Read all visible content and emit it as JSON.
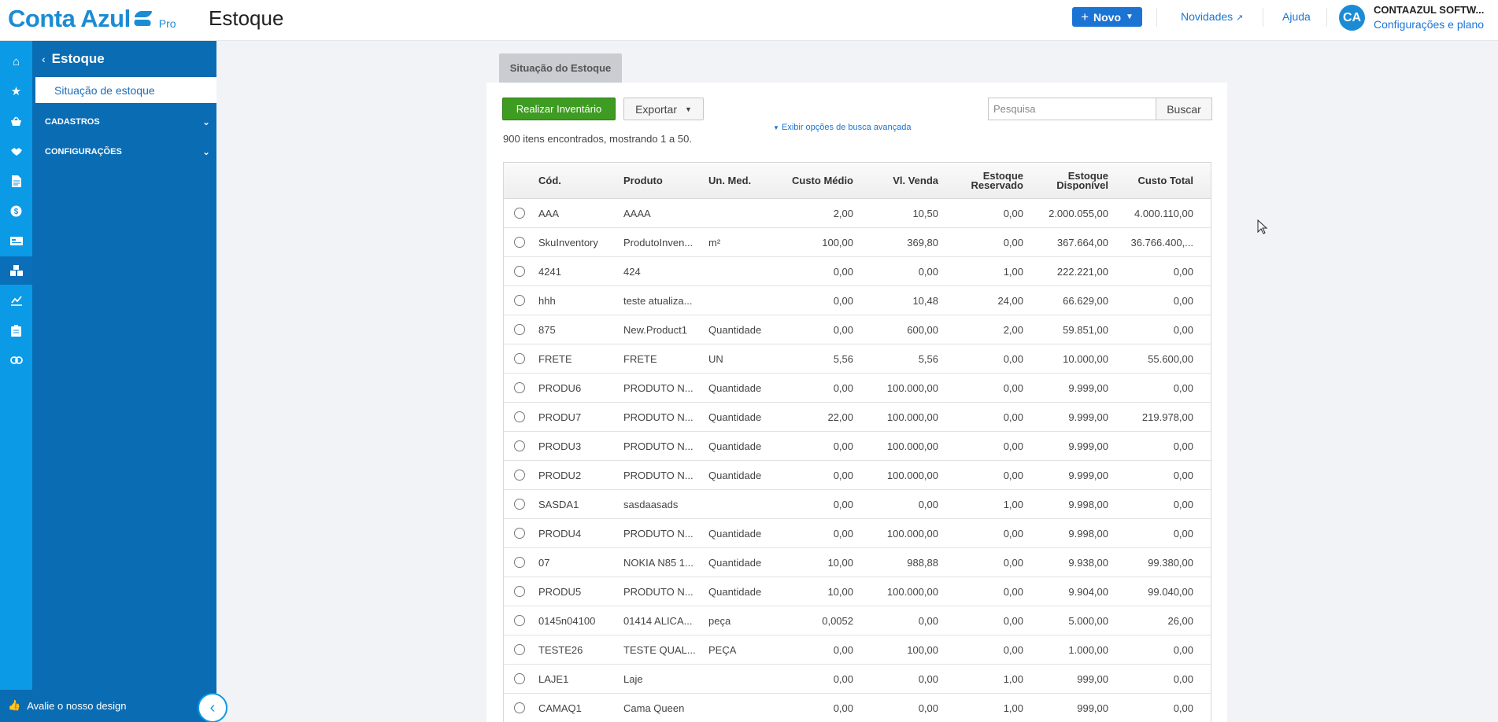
{
  "header": {
    "logo_text": "Conta Azul",
    "logo_pro": "Pro",
    "page_title": "Estoque",
    "novo_label": "Novo",
    "novidades_label": "Novidades",
    "ajuda_label": "Ajuda",
    "avatar_initials": "CA",
    "company_name": "CONTAAZUL SOFTW...",
    "config_link": "Configurações e plano"
  },
  "rail": {
    "icons": [
      "home-icon",
      "star-icon",
      "basket-icon",
      "handshake-icon",
      "document-icon",
      "money-icon",
      "card-icon",
      "inventory-icon",
      "chart-icon",
      "clipboard-icon",
      "link-icon"
    ],
    "active_icon": "inventory-icon"
  },
  "sidebar": {
    "title": "Estoque",
    "active_item": "Situação de estoque",
    "sections": [
      "CADASTROS",
      "CONFIGURAÇÕES"
    ],
    "rate_label": "Avalie o nosso design"
  },
  "main": {
    "tab_label": "Situação do Estoque",
    "inventory_button": "Realizar Inventário",
    "export_button": "Exportar",
    "search_placeholder": "Pesquisa",
    "search_button": "Buscar",
    "advanced_link": "Exibir opções de busca avançada",
    "results_text": "900 itens encontrados, mostrando 1 a 50."
  },
  "table": {
    "headers": {
      "cod": "Cód.",
      "produto": "Produto",
      "un": "Un. Med.",
      "custo": "Custo Médio",
      "venda": "Vl. Venda",
      "reservado": "Estoque Reservado",
      "disponivel": "Estoque Disponível",
      "total": "Custo Total"
    },
    "rows": [
      {
        "cod": "AAA",
        "produto": "AAAA",
        "un": "",
        "custo": "2,00",
        "venda": "10,50",
        "reservado": "0,00",
        "disponivel": "2.000.055,00",
        "total": "4.000.110,00"
      },
      {
        "cod": "SkuInventory",
        "produto": "ProdutoInven...",
        "un": "m²",
        "custo": "100,00",
        "venda": "369,80",
        "reservado": "0,00",
        "disponivel": "367.664,00",
        "total": "36.766.400,..."
      },
      {
        "cod": "4241",
        "produto": "424",
        "un": "",
        "custo": "0,00",
        "venda": "0,00",
        "reservado": "1,00",
        "disponivel": "222.221,00",
        "total": "0,00"
      },
      {
        "cod": "hhh",
        "produto": "teste atualiza...",
        "un": "",
        "custo": "0,00",
        "venda": "10,48",
        "reservado": "24,00",
        "disponivel": "66.629,00",
        "total": "0,00"
      },
      {
        "cod": "875",
        "produto": "New.Product1",
        "un": "Quantidade",
        "custo": "0,00",
        "venda": "600,00",
        "reservado": "2,00",
        "disponivel": "59.851,00",
        "total": "0,00"
      },
      {
        "cod": "FRETE",
        "produto": "FRETE",
        "un": "UN",
        "custo": "5,56",
        "venda": "5,56",
        "reservado": "0,00",
        "disponivel": "10.000,00",
        "total": "55.600,00"
      },
      {
        "cod": "PRODU6",
        "produto": "PRODUTO N...",
        "un": "Quantidade",
        "custo": "0,00",
        "venda": "100.000,00",
        "reservado": "0,00",
        "disponivel": "9.999,00",
        "total": "0,00"
      },
      {
        "cod": "PRODU7",
        "produto": "PRODUTO N...",
        "un": "Quantidade",
        "custo": "22,00",
        "venda": "100.000,00",
        "reservado": "0,00",
        "disponivel": "9.999,00",
        "total": "219.978,00"
      },
      {
        "cod": "PRODU3",
        "produto": "PRODUTO N...",
        "un": "Quantidade",
        "custo": "0,00",
        "venda": "100.000,00",
        "reservado": "0,00",
        "disponivel": "9.999,00",
        "total": "0,00"
      },
      {
        "cod": "PRODU2",
        "produto": "PRODUTO N...",
        "un": "Quantidade",
        "custo": "0,00",
        "venda": "100.000,00",
        "reservado": "0,00",
        "disponivel": "9.999,00",
        "total": "0,00"
      },
      {
        "cod": "SASDA1",
        "produto": "sasdaasads",
        "un": "",
        "custo": "0,00",
        "venda": "0,00",
        "reservado": "1,00",
        "disponivel": "9.998,00",
        "total": "0,00"
      },
      {
        "cod": "PRODU4",
        "produto": "PRODUTO N...",
        "un": "Quantidade",
        "custo": "0,00",
        "venda": "100.000,00",
        "reservado": "0,00",
        "disponivel": "9.998,00",
        "total": "0,00"
      },
      {
        "cod": "07",
        "produto": "NOKIA N85 1...",
        "un": "Quantidade",
        "custo": "10,00",
        "venda": "988,88",
        "reservado": "0,00",
        "disponivel": "9.938,00",
        "total": "99.380,00"
      },
      {
        "cod": "PRODU5",
        "produto": "PRODUTO N...",
        "un": "Quantidade",
        "custo": "10,00",
        "venda": "100.000,00",
        "reservado": "0,00",
        "disponivel": "9.904,00",
        "total": "99.040,00"
      },
      {
        "cod": "0145n04100",
        "produto": "01414 ALICA...",
        "un": "peça",
        "custo": "0,0052",
        "venda": "0,00",
        "reservado": "0,00",
        "disponivel": "5.000,00",
        "total": "26,00"
      },
      {
        "cod": "TESTE26",
        "produto": "TESTE QUAL...",
        "un": "PEÇA",
        "custo": "0,00",
        "venda": "100,00",
        "reservado": "0,00",
        "disponivel": "1.000,00",
        "total": "0,00"
      },
      {
        "cod": "LAJE1",
        "produto": "Laje",
        "un": "",
        "custo": "0,00",
        "venda": "0,00",
        "reservado": "1,00",
        "disponivel": "999,00",
        "total": "0,00"
      },
      {
        "cod": "CAMAQ1",
        "produto": "Cama Queen",
        "un": "",
        "custo": "0,00",
        "venda": "0,00",
        "reservado": "1,00",
        "disponivel": "999,00",
        "total": "0,00"
      }
    ]
  },
  "colors": {
    "brand_blue": "#1b8cd4",
    "sidebar_blue": "#0a6cb3",
    "rail_blue": "#0b9ae6",
    "green_button": "#3f9c23"
  }
}
